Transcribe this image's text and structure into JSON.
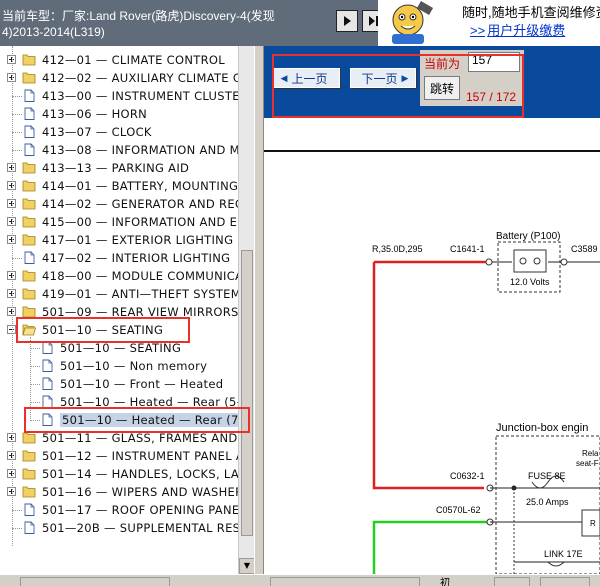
{
  "titlebar": {
    "line1": "当前车型：厂家:Land Rover(路虎)Discovery-4(发现",
    "line2": "4)2013-2014(L319)"
  },
  "ad": {
    "line1": "随时,随地手机查阅维修资",
    "arrows": ">>",
    "line2": "用户升级缴费"
  },
  "tree": {
    "items": [
      {
        "label": "412—01 — CLIMATE CONTROL",
        "icon": "folder-icon",
        "expander": "plus"
      },
      {
        "label": "412—02 — AUXILIARY CLIMATE C",
        "icon": "folder-icon",
        "expander": "plus"
      },
      {
        "label": "413—00 — INSTRUMENT CLUSTER",
        "icon": "document-icon",
        "expander": "none"
      },
      {
        "label": "413—06 — HORN",
        "icon": "document-icon",
        "expander": "none"
      },
      {
        "label": "413—07 — CLOCK",
        "icon": "document-icon",
        "expander": "none"
      },
      {
        "label": "413—08 — INFORMATION AND ME",
        "icon": "document-icon",
        "expander": "none"
      },
      {
        "label": "413—13 — PARKING AID",
        "icon": "folder-icon",
        "expander": "plus"
      },
      {
        "label": "414—01 — BATTERY, MOUNTING A",
        "icon": "folder-icon",
        "expander": "plus"
      },
      {
        "label": "414—02 — GENERATOR AND REG",
        "icon": "folder-icon",
        "expander": "plus"
      },
      {
        "label": "415—00 — INFORMATION AND EN",
        "icon": "folder-icon",
        "expander": "plus"
      },
      {
        "label": "417—01 — EXTERIOR LIGHTING",
        "icon": "folder-icon",
        "expander": "plus"
      },
      {
        "label": "417—02 — INTERIOR LIGHTING",
        "icon": "document-icon",
        "expander": "none"
      },
      {
        "label": "418—00 — MODULE COMMUNICAT",
        "icon": "folder-icon",
        "expander": "plus"
      },
      {
        "label": "419—01 — ANTI—THEFT SYSTEM",
        "icon": "folder-icon",
        "expander": "plus"
      },
      {
        "label": "501—09 — REAR VIEW MIRRORS",
        "icon": "folder-icon",
        "expander": "plus"
      },
      {
        "label": "501—10 — SEATING",
        "icon": "folder-open-icon",
        "expander": "minus"
      },
      {
        "label": "501—10 — SEATING",
        "icon": "document-icon",
        "expander": "child"
      },
      {
        "label": "501—10 — Non memory",
        "icon": "document-icon",
        "expander": "child"
      },
      {
        "label": "501—10 — Front — Heated",
        "icon": "document-icon",
        "expander": "child"
      },
      {
        "label": "501—10 — Heated — Rear (5—",
        "icon": "document-icon",
        "expander": "child"
      },
      {
        "label": "501—10 — Heated — Rear (7—",
        "icon": "document-icon",
        "expander": "child-selected"
      },
      {
        "label": "501—11 — GLASS, FRAMES AND I",
        "icon": "folder-icon",
        "expander": "plus"
      },
      {
        "label": "501—12 — INSTRUMENT PANEL AI",
        "icon": "folder-icon",
        "expander": "plus"
      },
      {
        "label": "501—14 — HANDLES, LOCKS, LAT",
        "icon": "folder-icon",
        "expander": "plus"
      },
      {
        "label": "501—16 — WIPERS AND WASHER",
        "icon": "folder-icon",
        "expander": "plus"
      },
      {
        "label": "501—17 — ROOF OPENING PANE",
        "icon": "document-icon",
        "expander": "none"
      },
      {
        "label": "501—20B — SUPPLEMENTAL REST",
        "icon": "document-icon",
        "expander": "none"
      }
    ]
  },
  "toolbar": {
    "prev_label": "上一页",
    "next_label": "下一页",
    "current_label": "当前为",
    "page_value": "157",
    "jump_label": "跳转",
    "page_count": "157 / 172"
  },
  "diagram": {
    "wire_left": "R,35.0D,295",
    "conn_c1641": "C1641-1",
    "battery_title": "Battery (P100)",
    "conn_c3589": "C3589",
    "battery_volts": "12.0 Volts",
    "junction_title": "Junction-box engin",
    "conn_c0632": "C0632-1",
    "fuse_label": "FUSE 8E",
    "fuse_amps": "25.0 Amps",
    "relay_l1": "Rela",
    "relay_l2": "seat-F",
    "conn_c0570": "C0570L-62",
    "link_label": "LINK 17E",
    "r_mark": "R"
  },
  "status": {
    "right_text": "初"
  }
}
